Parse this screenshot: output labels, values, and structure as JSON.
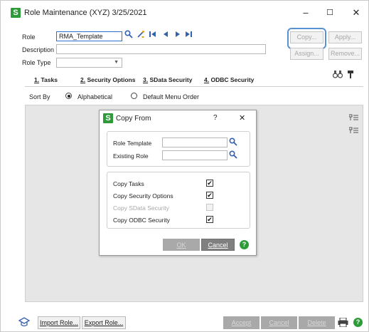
{
  "window": {
    "title": "Role Maintenance (XYZ) 3/25/2021",
    "logo_letter": "S",
    "minimize": "–",
    "maximize": "☐",
    "close": "✕"
  },
  "form": {
    "role_label": "Role",
    "role_value": "RMA_Template",
    "description_label": "Description",
    "description_value": "",
    "role_type_label": "Role Type",
    "role_type_value": "",
    "buttons": {
      "copy": "Copy...",
      "apply": "Apply...",
      "assign": "Assign...",
      "remove": "Remove..."
    }
  },
  "tabs": [
    {
      "key": "1.",
      "label": " Tasks"
    },
    {
      "key": "2.",
      "label": " Security Options"
    },
    {
      "key": "3.",
      "label": " SData Security"
    },
    {
      "key": "4.",
      "label": " ODBC Security"
    }
  ],
  "sort": {
    "label": "Sort By",
    "options": [
      "Alphabetical",
      "Default Menu Order"
    ],
    "selected": "Alphabetical"
  },
  "dialog": {
    "logo_letter": "S",
    "title": "Copy From",
    "help": "?",
    "close": "✕",
    "role_template_label": "Role Template",
    "role_template_value": "",
    "existing_role_label": "Existing Role",
    "existing_role_value": "",
    "options": [
      {
        "label": "Copy Tasks",
        "checked": true,
        "enabled": true
      },
      {
        "label": "Copy Security Options",
        "checked": true,
        "enabled": true
      },
      {
        "label": "Copy SData Security",
        "checked": false,
        "enabled": false
      },
      {
        "label": "Copy ODBC Security",
        "checked": true,
        "enabled": true
      }
    ],
    "ok": "OK",
    "cancel": "Cancel",
    "check_glyph": "✔"
  },
  "footer": {
    "import": "Import Role...",
    "export": "Export Role...",
    "accept": "Accept",
    "cancel": "Cancel",
    "delete": "Delete"
  },
  "colors": {
    "sage_green": "#2e9a3a",
    "focus_blue": "#5b8fd6",
    "panel_gray": "#e6e6e6",
    "disabled_button": "#a9a9a9"
  }
}
